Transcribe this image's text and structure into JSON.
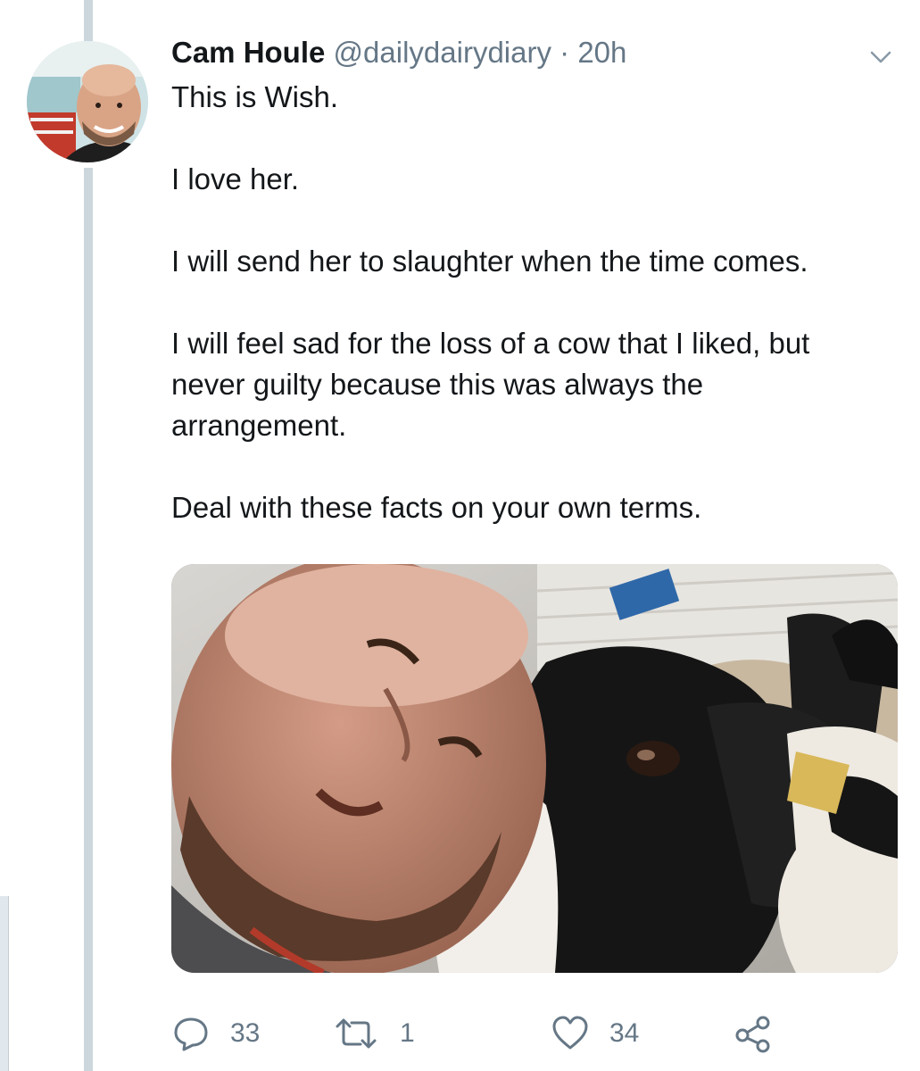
{
  "tweet": {
    "author_name": "Cam Houle",
    "handle": "@dailydairydiary",
    "separator": "·",
    "time": "20h",
    "paragraphs": [
      "This is Wish.",
      "I love her.",
      "I will send her to slaughter when the time comes.",
      "I will feel sad for the loss of a cow that I liked, but never guilty because this was always the arrangement.",
      "Deal with these facts on your own terms."
    ]
  },
  "actions": {
    "reply_count": "33",
    "retweet_count": "1",
    "like_count": "34"
  },
  "icons": {
    "more": "chevron-down-icon",
    "reply": "reply-icon",
    "retweet": "retweet-icon",
    "like": "heart-icon",
    "share": "share-icon"
  },
  "colors": {
    "text": "#14171a",
    "muted": "#657786",
    "thread_line": "#ccd6dd"
  }
}
